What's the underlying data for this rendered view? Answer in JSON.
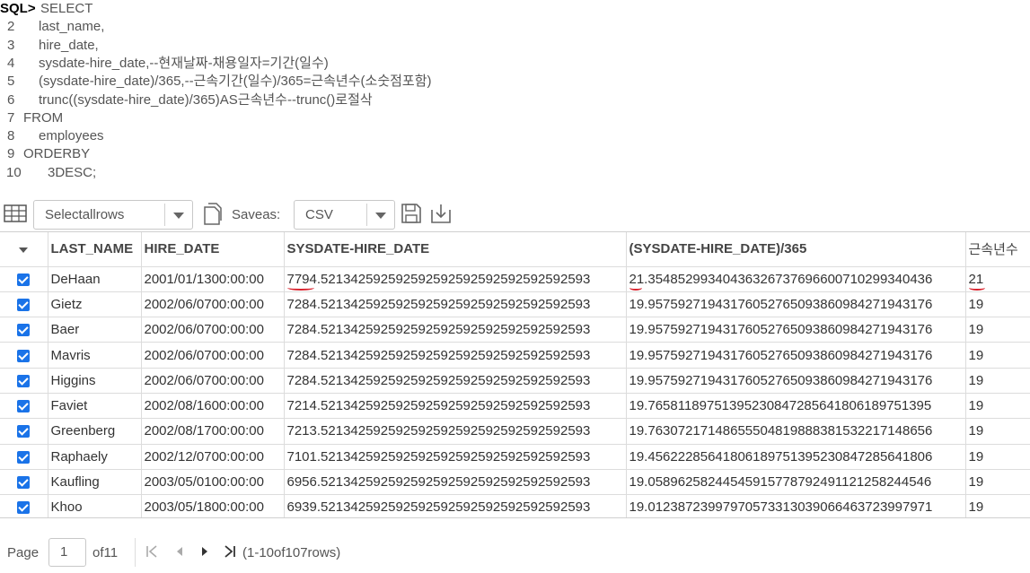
{
  "editor": {
    "prompt": "SQL>",
    "lines": [
      {
        "num": "",
        "code": "SELECT"
      },
      {
        "num": "2",
        "code": "last_name,"
      },
      {
        "num": "3",
        "code": "hire_date,"
      },
      {
        "num": "4",
        "code": "sysdate - hire_date,            -- 현재날짜 - 채용일자 = 기간(일수)"
      },
      {
        "num": "5",
        "code": "(sysdate - hire_date) / 365,    -- 근속기간(일수) / 365 = 근속년수(소숫점포함)"
      },
      {
        "num": "6",
        "code": "trunc( (sysdate - hire_date) / 365 ) AS 근속년수 -- trunc()로 절삭"
      },
      {
        "num": "7",
        "code": "FROM"
      },
      {
        "num": "8",
        "code": "employees"
      },
      {
        "num": "9",
        "code": "ORDER BY"
      },
      {
        "num": "10",
        "code": "3 DESC;"
      }
    ]
  },
  "toolbar": {
    "row_select": "Select all rows",
    "save_as_label": "Save as:",
    "format": "CSV",
    "icons": [
      "grid-icon",
      "document-icon",
      "floppy-disk-icon",
      "download-icon"
    ]
  },
  "grid": {
    "columns": [
      "LAST_NAME",
      "HIRE_DATE",
      "SYSDATE-HIRE_DATE",
      "(SYSDATE-HIRE_DATE)/365",
      "근속년수"
    ],
    "rows": [
      {
        "last_name": "De Haan",
        "hire_date": "2001/01/13 00:00:00",
        "days": "7794.521342592592592592592592592592592593",
        "years": "21.354852993404363267376966007102993404 36",
        "trunc": "21"
      },
      {
        "last_name": "Gietz",
        "hire_date": "2002/06/07 00:00:00",
        "days": "7284.521342592592592592592592592592592593",
        "years": "19.957592719431760527650938609842719431 76",
        "trunc": "19"
      },
      {
        "last_name": "Baer",
        "hire_date": "2002/06/07 00:00:00",
        "days": "7284.521342592592592592592592592592592593",
        "years": "19.957592719431760527650938609842719431 76",
        "trunc": "19"
      },
      {
        "last_name": "Mavris",
        "hire_date": "2002/06/07 00:00:00",
        "days": "7284.521342592592592592592592592592592593",
        "years": "19.957592719431760527650938609842719431 76",
        "trunc": "19"
      },
      {
        "last_name": "Higgins",
        "hire_date": "2002/06/07 00:00:00",
        "days": "7284.521342592592592592592592592592592593",
        "years": "19.957592719431760527650938609842719431 76",
        "trunc": "19"
      },
      {
        "last_name": "Faviet",
        "hire_date": "2002/08/16 00:00:00",
        "days": "7214.521342592592592592592592592592592593",
        "years": "19.765811897513952308472856418061897513 95",
        "trunc": "19"
      },
      {
        "last_name": "Greenberg",
        "hire_date": "2002/08/17 00:00:00",
        "days": "7213.521342592592592592592592592592592593",
        "years": "19.763072171486555048198883815322171486 56",
        "trunc": "19"
      },
      {
        "last_name": "Raphaely",
        "hire_date": "2002/12/07 00:00:00",
        "days": "7101.521342592592592592592592592592592593",
        "years": "19.456222856418061897513952308472856418 06",
        "trunc": "19"
      },
      {
        "last_name": "Kaufling",
        "hire_date": "2003/05/01 00:00:00",
        "days": "6956.521342592592592592592592592592592593",
        "years": "19.058962582445459157787924911212582445 46",
        "trunc": "19"
      },
      {
        "last_name": "Khoo",
        "hire_date": "2003/05/18 00:00:00",
        "days": "6939.521342592592592592592592592592592593",
        "years": "19.012387239979705733130390664637239979 71",
        "trunc": "19"
      }
    ],
    "annotation_color": "#d9232e",
    "checkbox_color": "#1a73e8"
  },
  "pager": {
    "page_label": "Page",
    "page_value": "1",
    "of_label": "of 11",
    "rows_label": "(1-10 of 107 rows)"
  }
}
